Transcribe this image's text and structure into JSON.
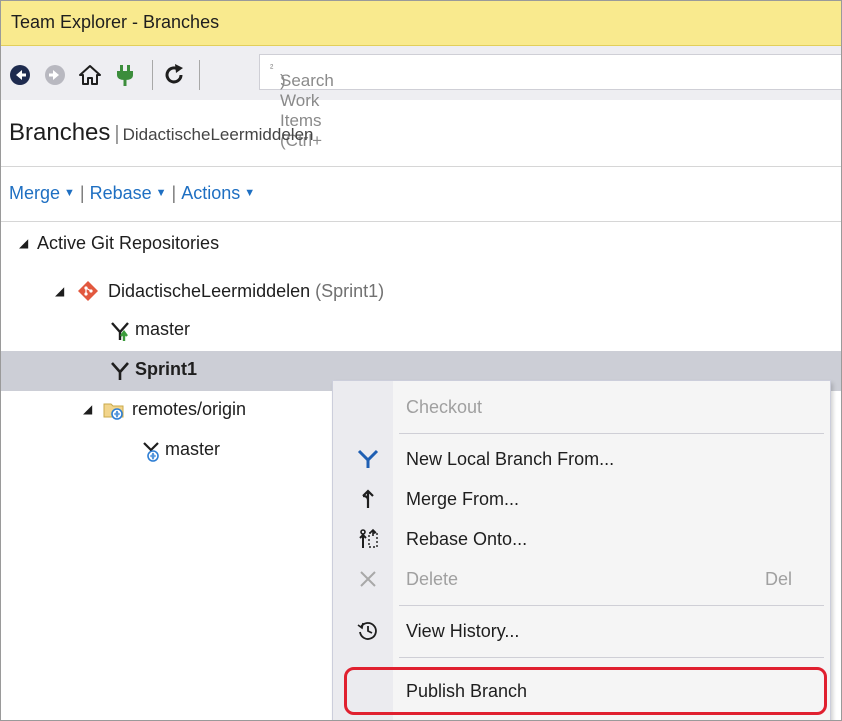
{
  "window": {
    "title": "Team Explorer - Branches"
  },
  "toolbar": {
    "icons": [
      "back-icon",
      "forward-icon",
      "home-icon",
      "connect-icon",
      "refresh-icon"
    ],
    "search_placeholder": "Search Work Items (Ctrl+",
    "search_placeholder_sup": "²",
    "search_placeholder_end": ")"
  },
  "header": {
    "title": "Branches",
    "separator": "|",
    "project": "DidactischeLeermiddelen"
  },
  "actions": {
    "merge": "Merge",
    "rebase": "Rebase",
    "actions": "Actions",
    "separator": "|"
  },
  "tree": {
    "section_label": "Active Git Repositories",
    "repo": {
      "name": "DidactischeLeermiddelen",
      "current_branch": "(Sprint1)"
    },
    "local_branches": [
      "master",
      "Sprint1"
    ],
    "remote": {
      "name": "remotes/origin",
      "branches": [
        "master"
      ]
    }
  },
  "context_menu": {
    "checkout": "Checkout",
    "new_local_branch": "New Local Branch From...",
    "merge_from": "Merge From...",
    "rebase_onto": "Rebase Onto...",
    "delete": "Delete",
    "delete_shortcut": "Del",
    "view_history": "View History...",
    "publish_branch": "Publish Branch"
  },
  "colors": {
    "title_bar": "#f9ea8e",
    "link_blue": "#1e6fc2",
    "selection": "#ccced6",
    "git_red": "#e2583e",
    "highlight_red": "#e0202f"
  }
}
